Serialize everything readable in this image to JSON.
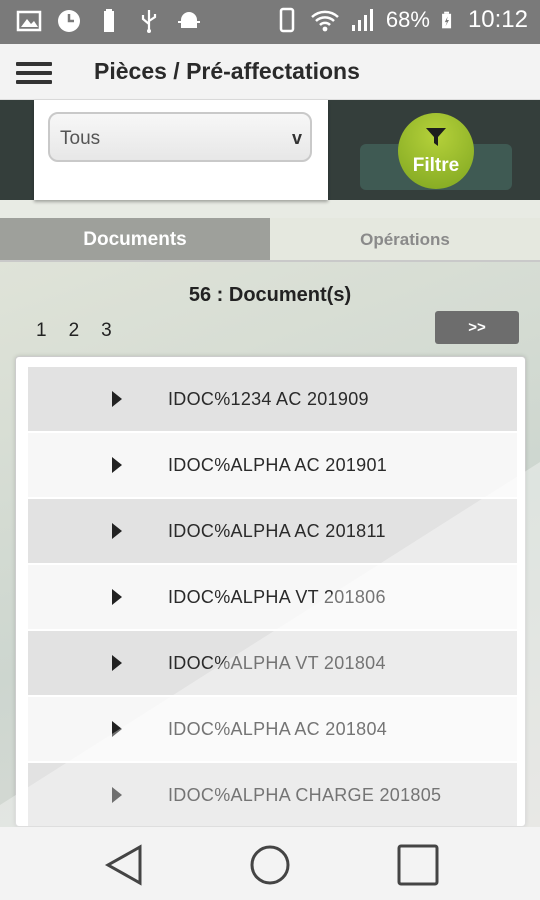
{
  "status_bar": {
    "battery_percent": "68%",
    "time": "10:12",
    "icons": [
      "image-icon",
      "clock-icon",
      "battery-small-icon",
      "usb-icon",
      "android-debug-icon",
      "phone-vibrate-icon",
      "wifi-icon",
      "signal-icon",
      "battery-charging-icon"
    ]
  },
  "app_bar": {
    "title": "Pièces / Pré-affectations"
  },
  "filter": {
    "select_value": "Tous",
    "select_caret": "v",
    "button_label": "Filtre",
    "accent_color": "#8db52a"
  },
  "tabs": [
    {
      "label": "Documents",
      "active": true
    },
    {
      "label": "Opérations",
      "active": false
    }
  ],
  "list_header": {
    "count": "56 : Document(s)",
    "pages": [
      "1",
      "2",
      "3"
    ],
    "current_page": "1",
    "next_label": ">>"
  },
  "documents": [
    "IDOC%1234 AC 201909",
    "IDOC%ALPHA AC 201901",
    "IDOC%ALPHA AC 201811",
    "IDOC%ALPHA VT 201806",
    "IDOC%ALPHA VT 201804",
    "IDOC%ALPHA AC 201804",
    "IDOC%ALPHA CHARGE 201805"
  ],
  "nav_bar": {
    "icons": [
      "back-icon",
      "home-icon",
      "recent-apps-icon"
    ]
  }
}
